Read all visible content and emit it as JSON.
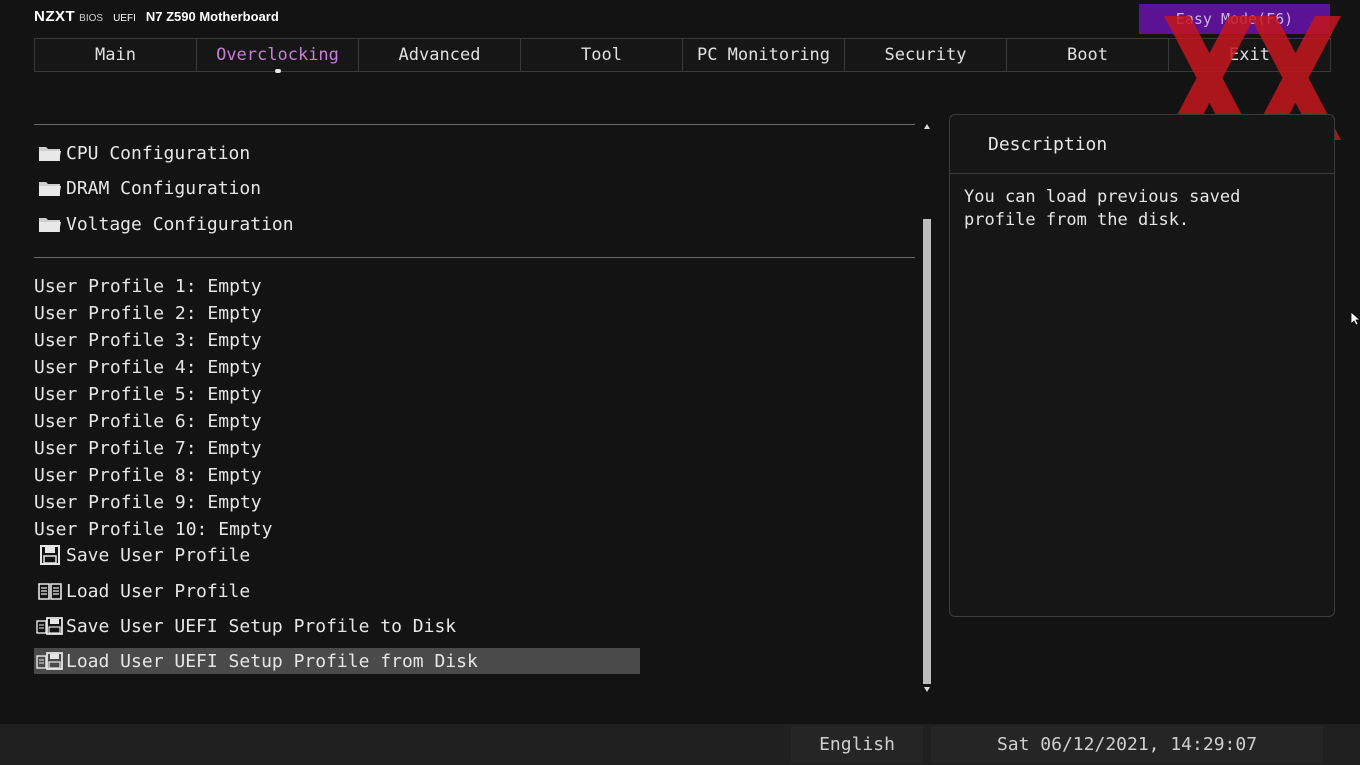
{
  "header": {
    "logo": "NZXT",
    "bios_label": "BIOS",
    "uefi_label": "UEFI",
    "model": "N7 Z590 Motherboard",
    "easy_mode": "Easy Mode(F6)"
  },
  "tabs": [
    "Main",
    "Overclocking",
    "Advanced",
    "Tool",
    "PC Monitoring",
    "Security",
    "Boot",
    "Exit"
  ],
  "active_tab": "Overclocking",
  "menu": {
    "config_items": [
      {
        "label": "CPU Configuration",
        "icon": "folder-icon"
      },
      {
        "label": "DRAM Configuration",
        "icon": "folder-icon"
      },
      {
        "label": "Voltage Configuration",
        "icon": "folder-icon"
      }
    ],
    "profiles": [
      "User Profile 1: Empty",
      "User Profile 2: Empty",
      "User Profile 3: Empty",
      "User Profile 4: Empty",
      "User Profile 5: Empty",
      "User Profile 6: Empty",
      "User Profile 7: Empty",
      "User Profile 8: Empty",
      "User Profile 9: Empty",
      "User Profile 10: Empty"
    ],
    "actions": [
      {
        "label": "Save User Profile",
        "icon": "floppy-disk-icon"
      },
      {
        "label": "Load User Profile",
        "icon": "open-book-icon"
      },
      {
        "label": "Save User UEFI Setup Profile to Disk",
        "icon": "disk-transfer-icon"
      },
      {
        "label": "Load User UEFI Setup Profile from Disk",
        "icon": "disk-transfer-icon",
        "selected": true
      }
    ]
  },
  "description": {
    "title": "Description",
    "text": "You can load previous saved profile from the disk."
  },
  "footer": {
    "language": "English",
    "datetime": "Sat 06/12/2021, 14:29:07"
  },
  "colors": {
    "accent_purple": "#5b1294",
    "active_tab_text": "#c77dd8",
    "selection_bg": "#4a4a4a",
    "watermark_red": "#c4161c"
  }
}
